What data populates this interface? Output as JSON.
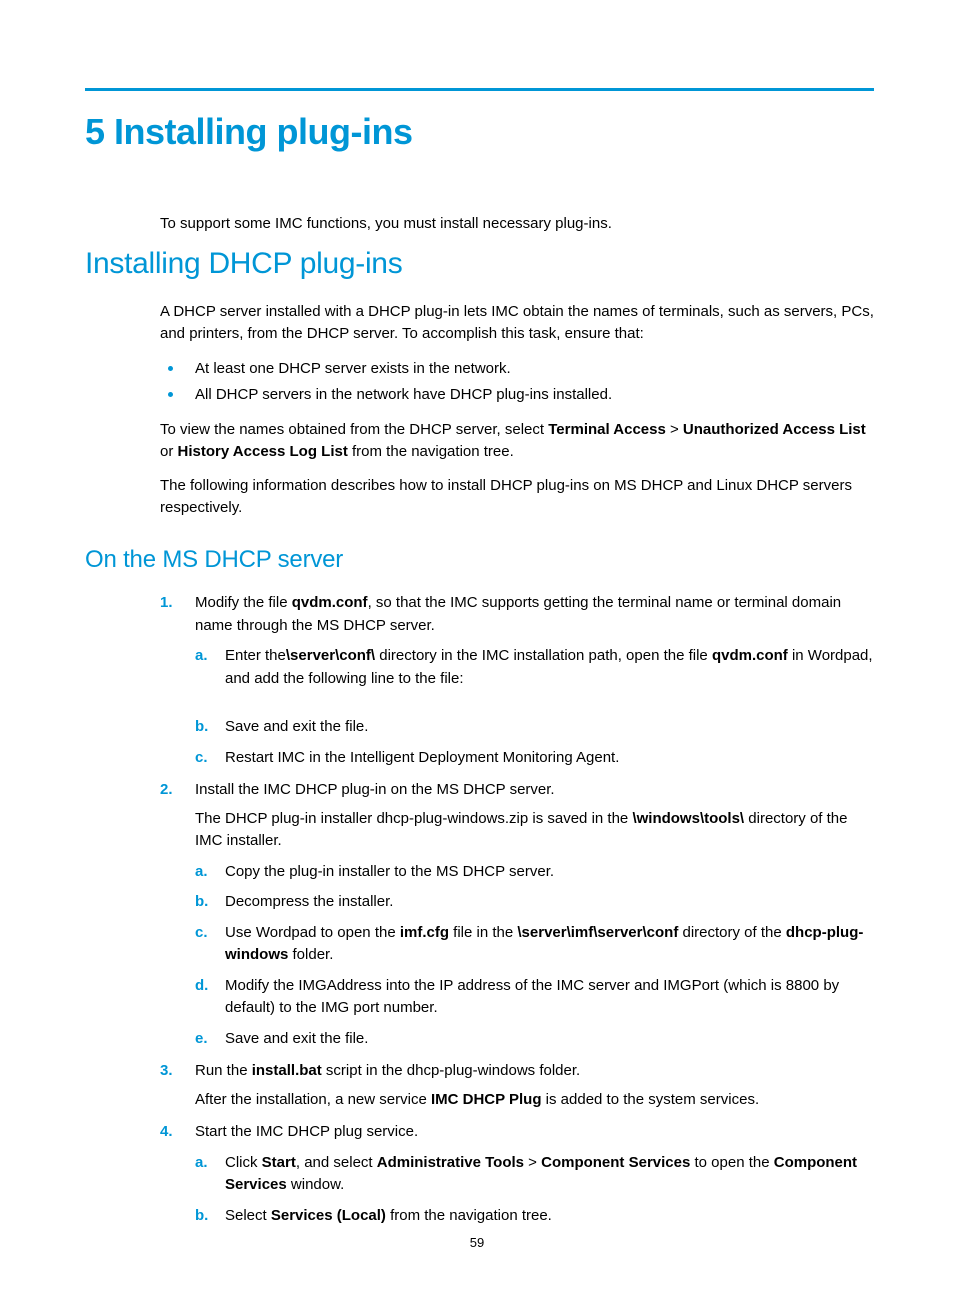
{
  "page_number": "59",
  "chapter_title": "5 Installing plug-ins",
  "intro": "To support some IMC functions, you must install necessary plug-ins.",
  "section1": {
    "title": "Installing DHCP plug-ins",
    "p1": "A DHCP server installed with a DHCP plug-in lets IMC obtain the names of terminals, such as servers, PCs, and printers, from the DHCP server. To accomplish this task, ensure that:",
    "bullets": {
      "b1": "At least one DHCP server exists in the network.",
      "b2": "All DHCP servers in the network have DHCP plug-ins installed."
    },
    "p2": {
      "t1": "To view the names obtained from the DHCP server, select ",
      "b1": "Terminal Access",
      "gt1": " > ",
      "b2": "Unauthorized Access List",
      "t2": " or ",
      "b3": "History Access Log List",
      "t3": " from the navigation tree."
    },
    "p3": "The following information describes how to install DHCP plug-ins on MS DHCP and Linux DHCP servers respectively."
  },
  "section2": {
    "title": "On the MS DHCP server",
    "step1": {
      "lead": {
        "t1": "Modify the file ",
        "b1": "qvdm.conf",
        "t2": ", so that the IMC supports getting the terminal name or terminal domain name through the MS DHCP server."
      },
      "a": {
        "t1": "Enter the",
        "b1": "\\server\\conf\\",
        "t2": " directory in the IMC installation path, open the file ",
        "b2": "qvdm.conf",
        "t3": " in Wordpad, and add the following line to the file:"
      },
      "b": "Save and exit the file.",
      "c": "Restart IMC in the Intelligent Deployment Monitoring Agent."
    },
    "step2": {
      "lead": "Install the IMC DHCP plug-in on the MS DHCP server.",
      "sub": {
        "t1": "The DHCP plug-in installer dhcp-plug-windows.zip is saved in the ",
        "b1": "\\windows\\tools\\",
        "t2": " directory of the IMC installer."
      },
      "a": "Copy the plug-in installer to the MS DHCP server.",
      "b": "Decompress the installer.",
      "c": {
        "t1": "Use Wordpad to open the ",
        "b1": "imf.cfg",
        "t2": " file in the ",
        "b2": "\\server\\imf\\server\\conf",
        "t3": " directory of the ",
        "b3": "dhcp-plug-windows",
        "t4": " folder."
      },
      "d": "Modify the IMGAddress into the IP address of the IMC server and IMGPort (which is 8800 by default) to the IMG port number.",
      "e": "Save and exit the file."
    },
    "step3": {
      "lead": {
        "t1": "Run the ",
        "b1": "install.bat",
        "t2": " script in the dhcp-plug-windows folder."
      },
      "sub": {
        "t1": "After the installation, a new service ",
        "b1": "IMC DHCP Plug",
        "t2": " is added to the system services."
      }
    },
    "step4": {
      "lead": "Start the IMC DHCP plug service.",
      "a": {
        "t1": "Click ",
        "b1": "Start",
        "t2": ", and select ",
        "b2": "Administrative Tools",
        "gt": " > ",
        "b3": "Component Services",
        "t3": " to open the ",
        "b4": "Component Services",
        "t4": " window."
      },
      "b": {
        "t1": "Select ",
        "b1": "Services (Local)",
        "t2": " from the navigation tree."
      }
    }
  }
}
